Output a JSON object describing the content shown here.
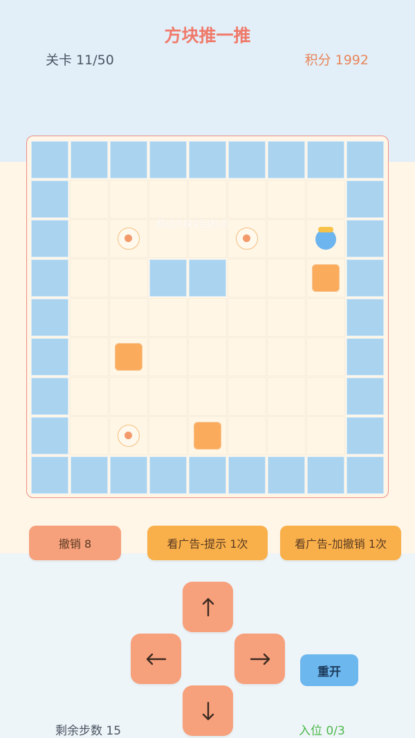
{
  "header": {
    "title": "方块推一推",
    "level": "关卡 11/50",
    "score": "积分 1992"
  },
  "board": {
    "hint": "移动方块到目标点",
    "columns": 9,
    "rows": 9
  },
  "actions": {
    "undo": "撤销 8",
    "hint": "看广告-提示 1次",
    "add_undo": "看广告-加撤销 1次"
  },
  "controls": {
    "up": "up-arrow-icon",
    "left": "left-arrow-icon",
    "right": "right-arrow-icon",
    "down": "down-arrow-icon",
    "restart": "重开"
  },
  "status": {
    "steps": "剩余步数 15",
    "placed": "入位 0/3"
  },
  "colors": {
    "wall": "#a9d3ef",
    "floor": "#fff6e6",
    "box": "#fbab5c",
    "player": "#6db5ee",
    "button": "#f7a07c",
    "accent": "#f9b04a"
  }
}
